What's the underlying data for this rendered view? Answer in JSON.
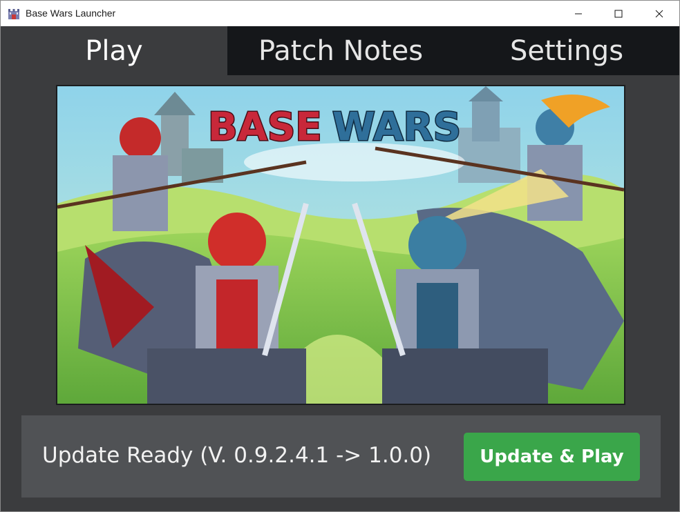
{
  "window": {
    "title": "Base Wars Launcher",
    "controls": {
      "minimize": "minimize-icon",
      "maximize": "maximize-icon",
      "close": "close-icon"
    }
  },
  "tabs": [
    {
      "label": "Play",
      "active": true
    },
    {
      "label": "Patch Notes",
      "active": false
    },
    {
      "label": "Settings",
      "active": false
    }
  ],
  "banner": {
    "logo_part1": "BASE",
    "logo_part2": "WARS"
  },
  "status": {
    "text": "Update Ready (V. 0.9.2.4.1 -> 1.0.0)",
    "button_label": "Update & Play"
  },
  "colors": {
    "accent_green": "#3aa64a",
    "tab_active_bg": "#3b3c3e",
    "tab_inactive_bg": "#15171a",
    "panel_bg": "#505255",
    "logo_red": "#c8283a",
    "logo_blue": "#2f6f9a"
  }
}
